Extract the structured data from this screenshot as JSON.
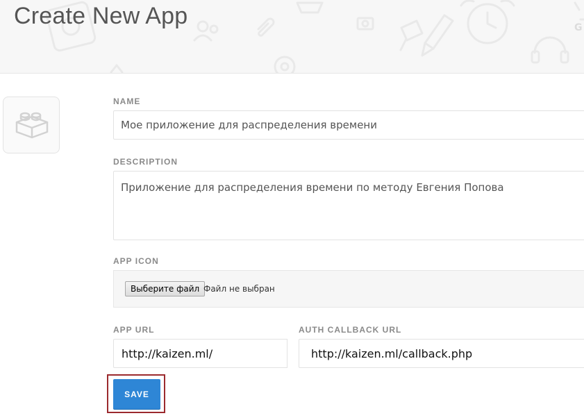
{
  "header": {
    "title": "Create New App"
  },
  "form": {
    "name": {
      "label": "NAME",
      "value": "Мое приложение для распределения времени"
    },
    "description": {
      "label": "DESCRIPTION",
      "value": "Приложение для распределения времени по методу Евгения Попова"
    },
    "app_icon": {
      "label": "APP ICON",
      "button_label": "Выберите файл",
      "status": "Файл не выбран"
    },
    "app_url": {
      "label": "APP URL",
      "value": "http://kaizen.ml/"
    },
    "auth_callback_url": {
      "label": "AUTH CALLBACK URL",
      "value": "http://kaizen.ml/callback.php"
    },
    "save_label": "SAVE"
  },
  "colors": {
    "save_button": "#2e86d6",
    "highlight_border": "#9b2a2e",
    "header_bg": "#f7f7f7"
  },
  "icons": {
    "app_placeholder": "lego-brick-icon"
  }
}
